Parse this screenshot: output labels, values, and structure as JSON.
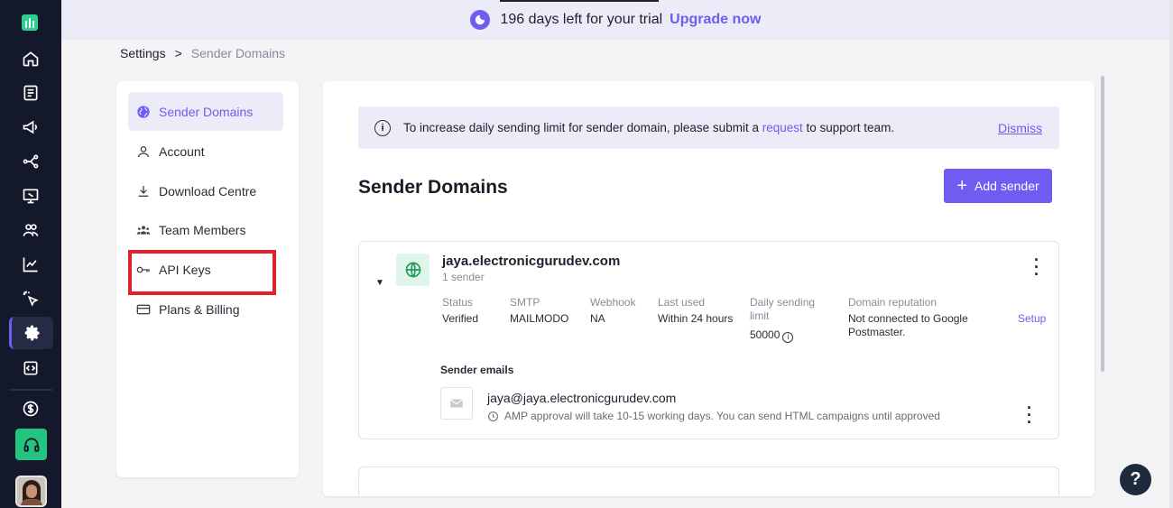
{
  "banner": {
    "trial_text": "196 days left for your trial",
    "upgrade_label": "Upgrade now"
  },
  "breadcrumb": {
    "root": "Settings",
    "separator": ">",
    "current": "Sender Domains"
  },
  "settings_nav": {
    "items": [
      {
        "label": "Sender Domains",
        "icon": "globe-icon",
        "active": true
      },
      {
        "label": "Account",
        "icon": "user-icon",
        "active": false
      },
      {
        "label": "Download Centre",
        "icon": "download-icon",
        "active": false
      },
      {
        "label": "Team Members",
        "icon": "team-icon",
        "active": false
      },
      {
        "label": "API Keys",
        "icon": "key-icon",
        "active": false
      },
      {
        "label": "Plans & Billing",
        "icon": "credit-card-icon",
        "active": false
      }
    ]
  },
  "notice": {
    "text_before": "To increase daily sending limit for sender domain, please submit a",
    "link_text": "request",
    "text_after": "to support team.",
    "dismiss_label": "Dismiss"
  },
  "page": {
    "title": "Sender Domains",
    "add_button_label": "Add sender"
  },
  "domain_card": {
    "domain": "jaya.electronicgurudev.com",
    "sender_count": "1 sender",
    "columns": [
      {
        "header": "Status",
        "value": "Verified"
      },
      {
        "header": "SMTP",
        "value": "MAILMODO"
      },
      {
        "header": "Webhook",
        "value": "NA"
      },
      {
        "header": "Last used",
        "value": "Within 24 hours"
      },
      {
        "header": "Daily sending limit",
        "value": "50000"
      },
      {
        "header": "Domain reputation",
        "value": "Not connected to Google Postmaster."
      }
    ],
    "setup_label": "Setup",
    "sender_emails_label": "Sender emails",
    "sender_email": "jaya@jaya.electronicgurudev.com",
    "amp_note": "AMP approval will take 10-15 working days. You can send HTML campaigns until approved"
  },
  "colors": {
    "accent": "#6f5cf1",
    "rail_bg": "#13182a",
    "brand_green": "#2ecf8e",
    "highlight": "#e5202b"
  },
  "rail_icons": [
    "home-icon",
    "document-icon",
    "megaphone-icon",
    "journey-icon",
    "template-icon",
    "audience-icon",
    "analytics-icon",
    "click-icon",
    "settings-icon",
    "code-icon",
    "billing-icon",
    "headset-icon"
  ]
}
